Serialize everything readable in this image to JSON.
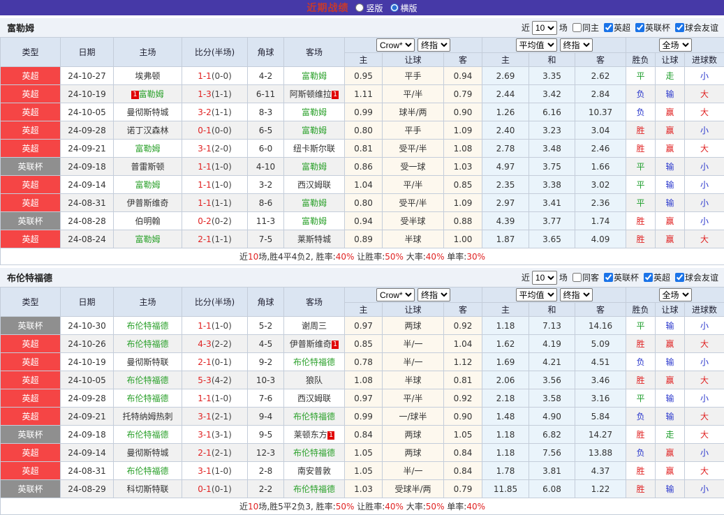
{
  "topbar": {
    "title": "近期战绩",
    "orientation_options": [
      {
        "label": "竖版",
        "selected": false
      },
      {
        "label": "横版",
        "selected": true
      }
    ]
  },
  "colors": {
    "topbar_bg": "#4639a7",
    "title_red": "#c53a2e",
    "league_epl_bg": "#f54545",
    "league_cup_bg": "#8f8f8f",
    "team_green": "#2ca12c",
    "score_red": "#e02222",
    "win_red": "#e02222",
    "draw_green": "#1f9e2c",
    "loss_blue": "#2936cc",
    "card_red": "#e00000",
    "handicap_col_bg": "#fdf8ee",
    "average_col_bg": "#eaf4fb",
    "header_bg": "#dbe5f2"
  },
  "value_color_map": {
    "胜": "win",
    "平": "draw",
    "负": "loss",
    "赢": "win",
    "走": "draw",
    "输": "loss",
    "大": "win",
    "小": "loss"
  },
  "league_bg_map": {
    "英超": "#f54545",
    "英联杯": "#8f8f8f"
  },
  "table_header": {
    "left_cols": [
      "类型",
      "日期",
      "主场",
      "比分(半场)",
      "角球",
      "客场"
    ],
    "sub_cols": [
      "主",
      "让球",
      "客",
      "主",
      "和",
      "客",
      "胜负",
      "让球",
      "进球数"
    ]
  },
  "sections": [
    {
      "team": "富勒姆",
      "filter": {
        "prefix": "近",
        "count_value": "10",
        "suffix": "场",
        "checks": [
          {
            "label": "同主",
            "checked": false
          },
          {
            "label": "英超",
            "checked": true
          },
          {
            "label": "英联杯",
            "checked": true
          },
          {
            "label": "球会友谊",
            "checked": true
          }
        ]
      },
      "group_selects": [
        [
          "Crow*",
          "终指"
        ],
        [
          "平均值",
          "终指"
        ],
        [
          "全场"
        ]
      ],
      "rows": [
        {
          "league": "英超",
          "date": "24-10-27",
          "home": {
            "name": "埃弗顿",
            "team": false,
            "card": false
          },
          "score": "1-1",
          "half": "(0-0)",
          "corners": "4-2",
          "away": {
            "name": "富勒姆",
            "team": true,
            "card": false
          },
          "handicap_odds": [
            "0.95",
            "平手",
            "0.94"
          ],
          "avg_odds": [
            "2.69",
            "3.35",
            "2.62"
          ],
          "outcome": [
            "平",
            "走",
            "小"
          ]
        },
        {
          "league": "英超",
          "date": "24-10-19",
          "home": {
            "name": "富勒姆",
            "team": true,
            "card": true
          },
          "score": "1-3",
          "half": "(1-1)",
          "corners": "6-11",
          "away": {
            "name": "阿斯顿维拉",
            "team": false,
            "card": true
          },
          "handicap_odds": [
            "1.11",
            "平/半",
            "0.79"
          ],
          "avg_odds": [
            "2.44",
            "3.42",
            "2.84"
          ],
          "outcome": [
            "负",
            "输",
            "大"
          ]
        },
        {
          "league": "英超",
          "date": "24-10-05",
          "home": {
            "name": "曼彻斯特城",
            "team": false,
            "card": false
          },
          "score": "3-2",
          "half": "(1-1)",
          "corners": "8-3",
          "away": {
            "name": "富勒姆",
            "team": true,
            "card": false
          },
          "handicap_odds": [
            "0.99",
            "球半/两",
            "0.90"
          ],
          "avg_odds": [
            "1.26",
            "6.16",
            "10.37"
          ],
          "outcome": [
            "负",
            "赢",
            "大"
          ]
        },
        {
          "league": "英超",
          "date": "24-09-28",
          "home": {
            "name": "诺丁汉森林",
            "team": false,
            "card": false
          },
          "score": "0-1",
          "half": "(0-0)",
          "corners": "6-5",
          "away": {
            "name": "富勒姆",
            "team": true,
            "card": false
          },
          "handicap_odds": [
            "0.80",
            "平手",
            "1.09"
          ],
          "avg_odds": [
            "2.40",
            "3.23",
            "3.04"
          ],
          "outcome": [
            "胜",
            "赢",
            "小"
          ]
        },
        {
          "league": "英超",
          "date": "24-09-21",
          "home": {
            "name": "富勒姆",
            "team": true,
            "card": false
          },
          "score": "3-1",
          "half": "(2-0)",
          "corners": "6-0",
          "away": {
            "name": "纽卡斯尔联",
            "team": false,
            "card": false
          },
          "handicap_odds": [
            "0.81",
            "受平/半",
            "1.08"
          ],
          "avg_odds": [
            "2.78",
            "3.48",
            "2.46"
          ],
          "outcome": [
            "胜",
            "赢",
            "大"
          ]
        },
        {
          "league": "英联杯",
          "date": "24-09-18",
          "home": {
            "name": "普雷斯顿",
            "team": false,
            "card": false
          },
          "score": "1-1",
          "half": "(1-0)",
          "corners": "4-10",
          "away": {
            "name": "富勒姆",
            "team": true,
            "card": false
          },
          "handicap_odds": [
            "0.86",
            "受一球",
            "1.03"
          ],
          "avg_odds": [
            "4.97",
            "3.75",
            "1.66"
          ],
          "outcome": [
            "平",
            "输",
            "小"
          ]
        },
        {
          "league": "英超",
          "date": "24-09-14",
          "home": {
            "name": "富勒姆",
            "team": true,
            "card": false
          },
          "score": "1-1",
          "half": "(1-0)",
          "corners": "3-2",
          "away": {
            "name": "西汉姆联",
            "team": false,
            "card": false
          },
          "handicap_odds": [
            "1.04",
            "平/半",
            "0.85"
          ],
          "avg_odds": [
            "2.35",
            "3.38",
            "3.02"
          ],
          "outcome": [
            "平",
            "输",
            "小"
          ]
        },
        {
          "league": "英超",
          "date": "24-08-31",
          "home": {
            "name": "伊普斯维奇",
            "team": false,
            "card": false
          },
          "score": "1-1",
          "half": "(1-1)",
          "corners": "8-6",
          "away": {
            "name": "富勒姆",
            "team": true,
            "card": false
          },
          "handicap_odds": [
            "0.80",
            "受平/半",
            "1.09"
          ],
          "avg_odds": [
            "2.97",
            "3.41",
            "2.36"
          ],
          "outcome": [
            "平",
            "输",
            "小"
          ]
        },
        {
          "league": "英联杯",
          "date": "24-08-28",
          "home": {
            "name": "伯明翰",
            "team": false,
            "card": false
          },
          "score": "0-2",
          "half": "(0-2)",
          "corners": "11-3",
          "away": {
            "name": "富勒姆",
            "team": true,
            "card": false
          },
          "handicap_odds": [
            "0.94",
            "受半球",
            "0.88"
          ],
          "avg_odds": [
            "4.39",
            "3.77",
            "1.74"
          ],
          "outcome": [
            "胜",
            "赢",
            "小"
          ]
        },
        {
          "league": "英超",
          "date": "24-08-24",
          "home": {
            "name": "富勒姆",
            "team": true,
            "card": false
          },
          "score": "2-1",
          "half": "(1-1)",
          "corners": "7-5",
          "away": {
            "name": "莱斯特城",
            "team": false,
            "card": false
          },
          "handicap_odds": [
            "0.89",
            "半球",
            "1.00"
          ],
          "avg_odds": [
            "1.87",
            "3.65",
            "4.09"
          ],
          "outcome": [
            "胜",
            "赢",
            "大"
          ]
        }
      ],
      "summary": [
        [
          "近",
          "d"
        ],
        [
          "10",
          "r"
        ],
        [
          "场,胜4平4负2, 胜率:",
          "d"
        ],
        [
          "40%",
          "r"
        ],
        [
          " 让胜率:",
          "d"
        ],
        [
          "50%",
          "r"
        ],
        [
          " 大率:",
          "d"
        ],
        [
          "40%",
          "r"
        ],
        [
          " 单率:",
          "d"
        ],
        [
          "30%",
          "r"
        ]
      ]
    },
    {
      "team": "布伦特福德",
      "filter": {
        "prefix": "近",
        "count_value": "10",
        "suffix": "场",
        "checks": [
          {
            "label": "同客",
            "checked": false
          },
          {
            "label": "英联杯",
            "checked": true
          },
          {
            "label": "英超",
            "checked": true
          },
          {
            "label": "球会友谊",
            "checked": true
          }
        ]
      },
      "group_selects": [
        [
          "Crow*",
          "终指"
        ],
        [
          "平均值",
          "终指"
        ],
        [
          "全场"
        ]
      ],
      "rows": [
        {
          "league": "英联杯",
          "date": "24-10-30",
          "home": {
            "name": "布伦特福德",
            "team": true,
            "card": false
          },
          "score": "1-1",
          "half": "(1-0)",
          "corners": "5-2",
          "away": {
            "name": "谢周三",
            "team": false,
            "card": false
          },
          "handicap_odds": [
            "0.97",
            "两球",
            "0.92"
          ],
          "avg_odds": [
            "1.18",
            "7.13",
            "14.16"
          ],
          "outcome": [
            "平",
            "输",
            "小"
          ]
        },
        {
          "league": "英超",
          "date": "24-10-26",
          "home": {
            "name": "布伦特福德",
            "team": true,
            "card": false
          },
          "score": "4-3",
          "half": "(2-2)",
          "corners": "4-5",
          "away": {
            "name": "伊普斯维奇",
            "team": false,
            "card": true
          },
          "handicap_odds": [
            "0.85",
            "半/一",
            "1.04"
          ],
          "avg_odds": [
            "1.62",
            "4.19",
            "5.09"
          ],
          "outcome": [
            "胜",
            "赢",
            "大"
          ]
        },
        {
          "league": "英超",
          "date": "24-10-19",
          "home": {
            "name": "曼彻斯特联",
            "team": false,
            "card": false
          },
          "score": "2-1",
          "half": "(0-1)",
          "corners": "9-2",
          "away": {
            "name": "布伦特福德",
            "team": true,
            "card": false
          },
          "handicap_odds": [
            "0.78",
            "半/一",
            "1.12"
          ],
          "avg_odds": [
            "1.69",
            "4.21",
            "4.51"
          ],
          "outcome": [
            "负",
            "输",
            "小"
          ]
        },
        {
          "league": "英超",
          "date": "24-10-05",
          "home": {
            "name": "布伦特福德",
            "team": true,
            "card": false
          },
          "score": "5-3",
          "half": "(4-2)",
          "corners": "10-3",
          "away": {
            "name": "狼队",
            "team": false,
            "card": false
          },
          "handicap_odds": [
            "1.08",
            "半球",
            "0.81"
          ],
          "avg_odds": [
            "2.06",
            "3.56",
            "3.46"
          ],
          "outcome": [
            "胜",
            "赢",
            "大"
          ]
        },
        {
          "league": "英超",
          "date": "24-09-28",
          "home": {
            "name": "布伦特福德",
            "team": true,
            "card": false
          },
          "score": "1-1",
          "half": "(1-0)",
          "corners": "7-6",
          "away": {
            "name": "西汉姆联",
            "team": false,
            "card": false
          },
          "handicap_odds": [
            "0.97",
            "平/半",
            "0.92"
          ],
          "avg_odds": [
            "2.18",
            "3.58",
            "3.16"
          ],
          "outcome": [
            "平",
            "输",
            "小"
          ]
        },
        {
          "league": "英超",
          "date": "24-09-21",
          "home": {
            "name": "托特纳姆热刺",
            "team": false,
            "card": false
          },
          "score": "3-1",
          "half": "(2-1)",
          "corners": "9-4",
          "away": {
            "name": "布伦特福德",
            "team": true,
            "card": false
          },
          "handicap_odds": [
            "0.99",
            "一/球半",
            "0.90"
          ],
          "avg_odds": [
            "1.48",
            "4.90",
            "5.84"
          ],
          "outcome": [
            "负",
            "输",
            "大"
          ]
        },
        {
          "league": "英联杯",
          "date": "24-09-18",
          "home": {
            "name": "布伦特福德",
            "team": true,
            "card": false
          },
          "score": "3-1",
          "half": "(3-1)",
          "corners": "9-5",
          "away": {
            "name": "莱顿东方",
            "team": false,
            "card": true
          },
          "handicap_odds": [
            "0.84",
            "两球",
            "1.05"
          ],
          "avg_odds": [
            "1.18",
            "6.82",
            "14.27"
          ],
          "outcome": [
            "胜",
            "走",
            "大"
          ]
        },
        {
          "league": "英超",
          "date": "24-09-14",
          "home": {
            "name": "曼彻斯特城",
            "team": false,
            "card": false
          },
          "score": "2-1",
          "half": "(2-1)",
          "corners": "12-3",
          "away": {
            "name": "布伦特福德",
            "team": true,
            "card": false
          },
          "handicap_odds": [
            "1.05",
            "两球",
            "0.84"
          ],
          "avg_odds": [
            "1.18",
            "7.56",
            "13.88"
          ],
          "outcome": [
            "负",
            "赢",
            "小"
          ]
        },
        {
          "league": "英超",
          "date": "24-08-31",
          "home": {
            "name": "布伦特福德",
            "team": true,
            "card": false
          },
          "score": "3-1",
          "half": "(1-0)",
          "corners": "2-8",
          "away": {
            "name": "南安普敦",
            "team": false,
            "card": false
          },
          "handicap_odds": [
            "1.05",
            "半/一",
            "0.84"
          ],
          "avg_odds": [
            "1.78",
            "3.81",
            "4.37"
          ],
          "outcome": [
            "胜",
            "赢",
            "大"
          ]
        },
        {
          "league": "英联杯",
          "date": "24-08-29",
          "home": {
            "name": "科切斯特联",
            "team": false,
            "card": false
          },
          "score": "0-1",
          "half": "(0-1)",
          "corners": "2-2",
          "away": {
            "name": "布伦特福德",
            "team": true,
            "card": false
          },
          "handicap_odds": [
            "1.03",
            "受球半/两",
            "0.79"
          ],
          "avg_odds": [
            "11.85",
            "6.08",
            "1.22"
          ],
          "outcome": [
            "胜",
            "输",
            "小"
          ]
        }
      ],
      "summary": [
        [
          "近",
          "d"
        ],
        [
          "10",
          "r"
        ],
        [
          "场,胜5平2负3, 胜率:",
          "d"
        ],
        [
          "50%",
          "r"
        ],
        [
          " 让胜率:",
          "d"
        ],
        [
          "40%",
          "r"
        ],
        [
          " 大率:",
          "d"
        ],
        [
          "50%",
          "r"
        ],
        [
          " 单率:",
          "d"
        ],
        [
          "40%",
          "r"
        ]
      ]
    }
  ]
}
